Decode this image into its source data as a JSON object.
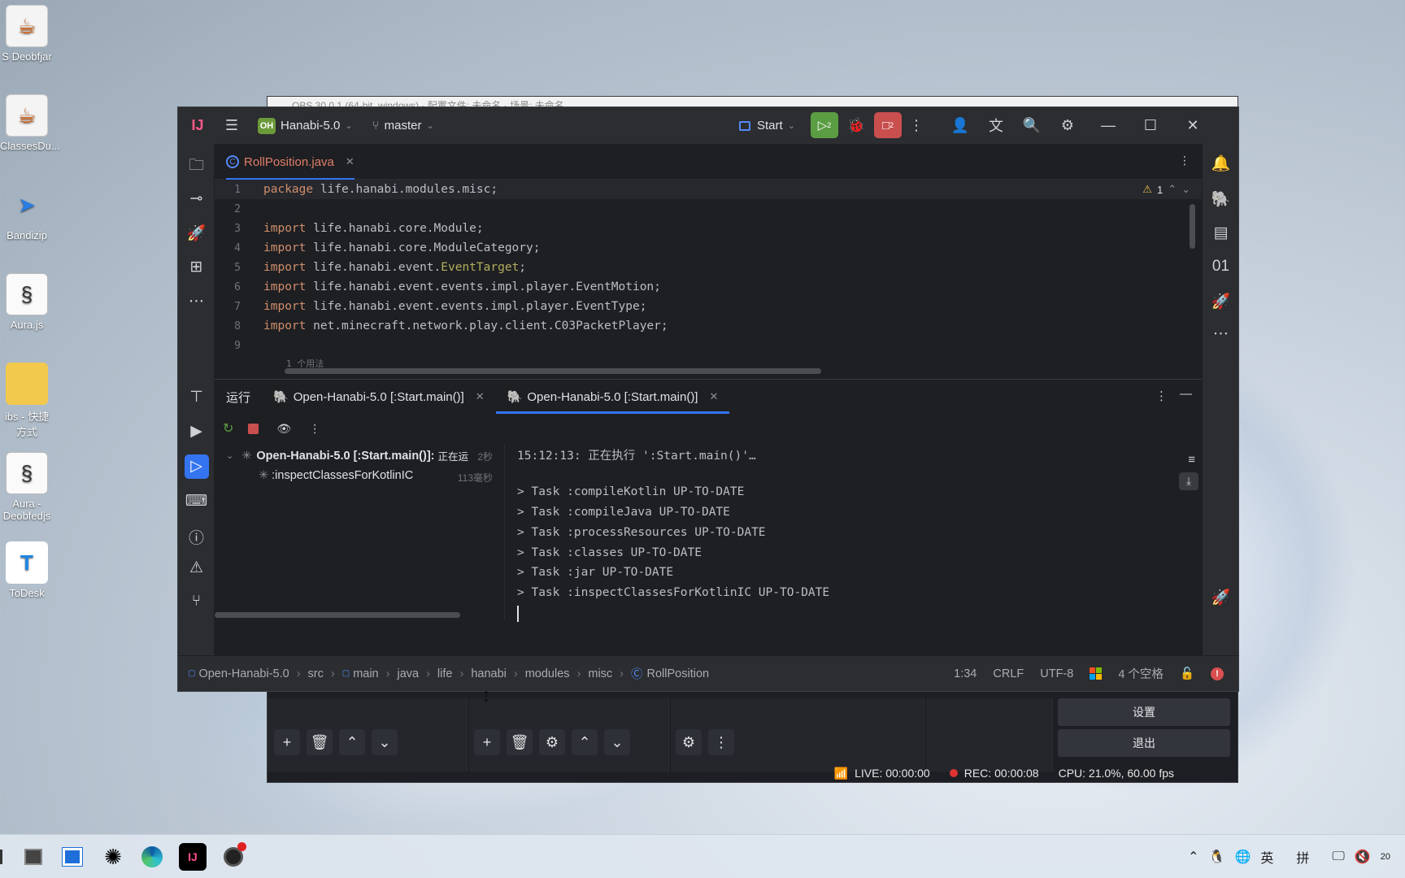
{
  "desktop": {
    "icons": [
      {
        "label": "S Deobfjar",
        "icon": "java-icon"
      },
      {
        "label": "ClassesDu...",
        "icon": "java-icon"
      },
      {
        "label": "Bandizip",
        "icon": "bandizip-icon"
      },
      {
        "label": "Aura.js",
        "icon": "js-file-icon"
      },
      {
        "label": "ibs - 快捷方式",
        "icon": "folder-icon"
      },
      {
        "label": "Aura - Deobfedjs",
        "icon": "js-file-icon"
      },
      {
        "label": "ToDesk",
        "icon": "todesk-icon"
      }
    ]
  },
  "obs": {
    "title": "OBS 30.0.1 (64-bit, windows) - 配置文件: 未命名 - 场景: 未命名",
    "settings_label": "设置",
    "exit_label": "退出",
    "status": {
      "live": "LIVE: 00:00:00",
      "rec": "REC: 00:00:08",
      "cpu": "CPU: 21.0%, 60.00 fps"
    }
  },
  "ide": {
    "project_badge": "OH",
    "project_name": "Hanabi-5.0",
    "branch": "master",
    "run_config": "Start",
    "run_count": "2",
    "stop_count": "2",
    "file_tab": "RollPosition.java",
    "warning_count": "1",
    "code": [
      {
        "n": "1",
        "kw": "package",
        "rest": " life.hanabi.modules.misc;"
      },
      {
        "n": "2",
        "kw": "",
        "rest": ""
      },
      {
        "n": "3",
        "kw": "import",
        "rest": " life.hanabi.core.Module;"
      },
      {
        "n": "4",
        "kw": "import",
        "rest": " life.hanabi.core.ModuleCategory;"
      },
      {
        "n": "5",
        "kw": "import",
        "rest": " life.hanabi.event.",
        "cls": "EventTarget",
        "tail": ";"
      },
      {
        "n": "6",
        "kw": "import",
        "rest": " life.hanabi.event.events.impl.player.EventMotion;"
      },
      {
        "n": "7",
        "kw": "import",
        "rest": " life.hanabi.event.events.impl.player.EventType;"
      },
      {
        "n": "8",
        "kw": "import",
        "rest": " net.minecraft.network.play.client.C03PacketPlayer;"
      },
      {
        "n": "9",
        "kw": "",
        "rest": ""
      }
    ],
    "usage_hint": "1 个用法",
    "run_panel": {
      "label": "运行",
      "tabs": [
        "Open-Hanabi-5.0 [:Start.main()]",
        "Open-Hanabi-5.0 [:Start.main()]"
      ],
      "tree": [
        {
          "label": "Open-Hanabi-5.0 [:Start.main()]:",
          "status": "正在运",
          "time": "2秒"
        },
        {
          "label": ":inspectClassesForKotlinIC",
          "status": "",
          "time": "113毫秒"
        }
      ],
      "console": [
        "15:12:13: 正在执行 ':Start.main()'…",
        "",
        "> Task :compileKotlin UP-TO-DATE",
        "> Task :compileJava UP-TO-DATE",
        "> Task :processResources UP-TO-DATE",
        "> Task :classes UP-TO-DATE",
        "> Task :jar UP-TO-DATE",
        "> Task :inspectClassesForKotlinIC UP-TO-DATE"
      ]
    },
    "breadcrumbs": [
      "Open-Hanabi-5.0",
      "src",
      "main",
      "java",
      "life",
      "hanabi",
      "modules",
      "misc",
      "RollPosition"
    ],
    "status": {
      "position": "1:34",
      "line_sep": "CRLF",
      "encoding": "UTF-8",
      "indent": "4 个空格"
    }
  },
  "taskbar": {
    "ime_lang": "英",
    "ime_mode": "拼",
    "clock_fragment": "20"
  }
}
